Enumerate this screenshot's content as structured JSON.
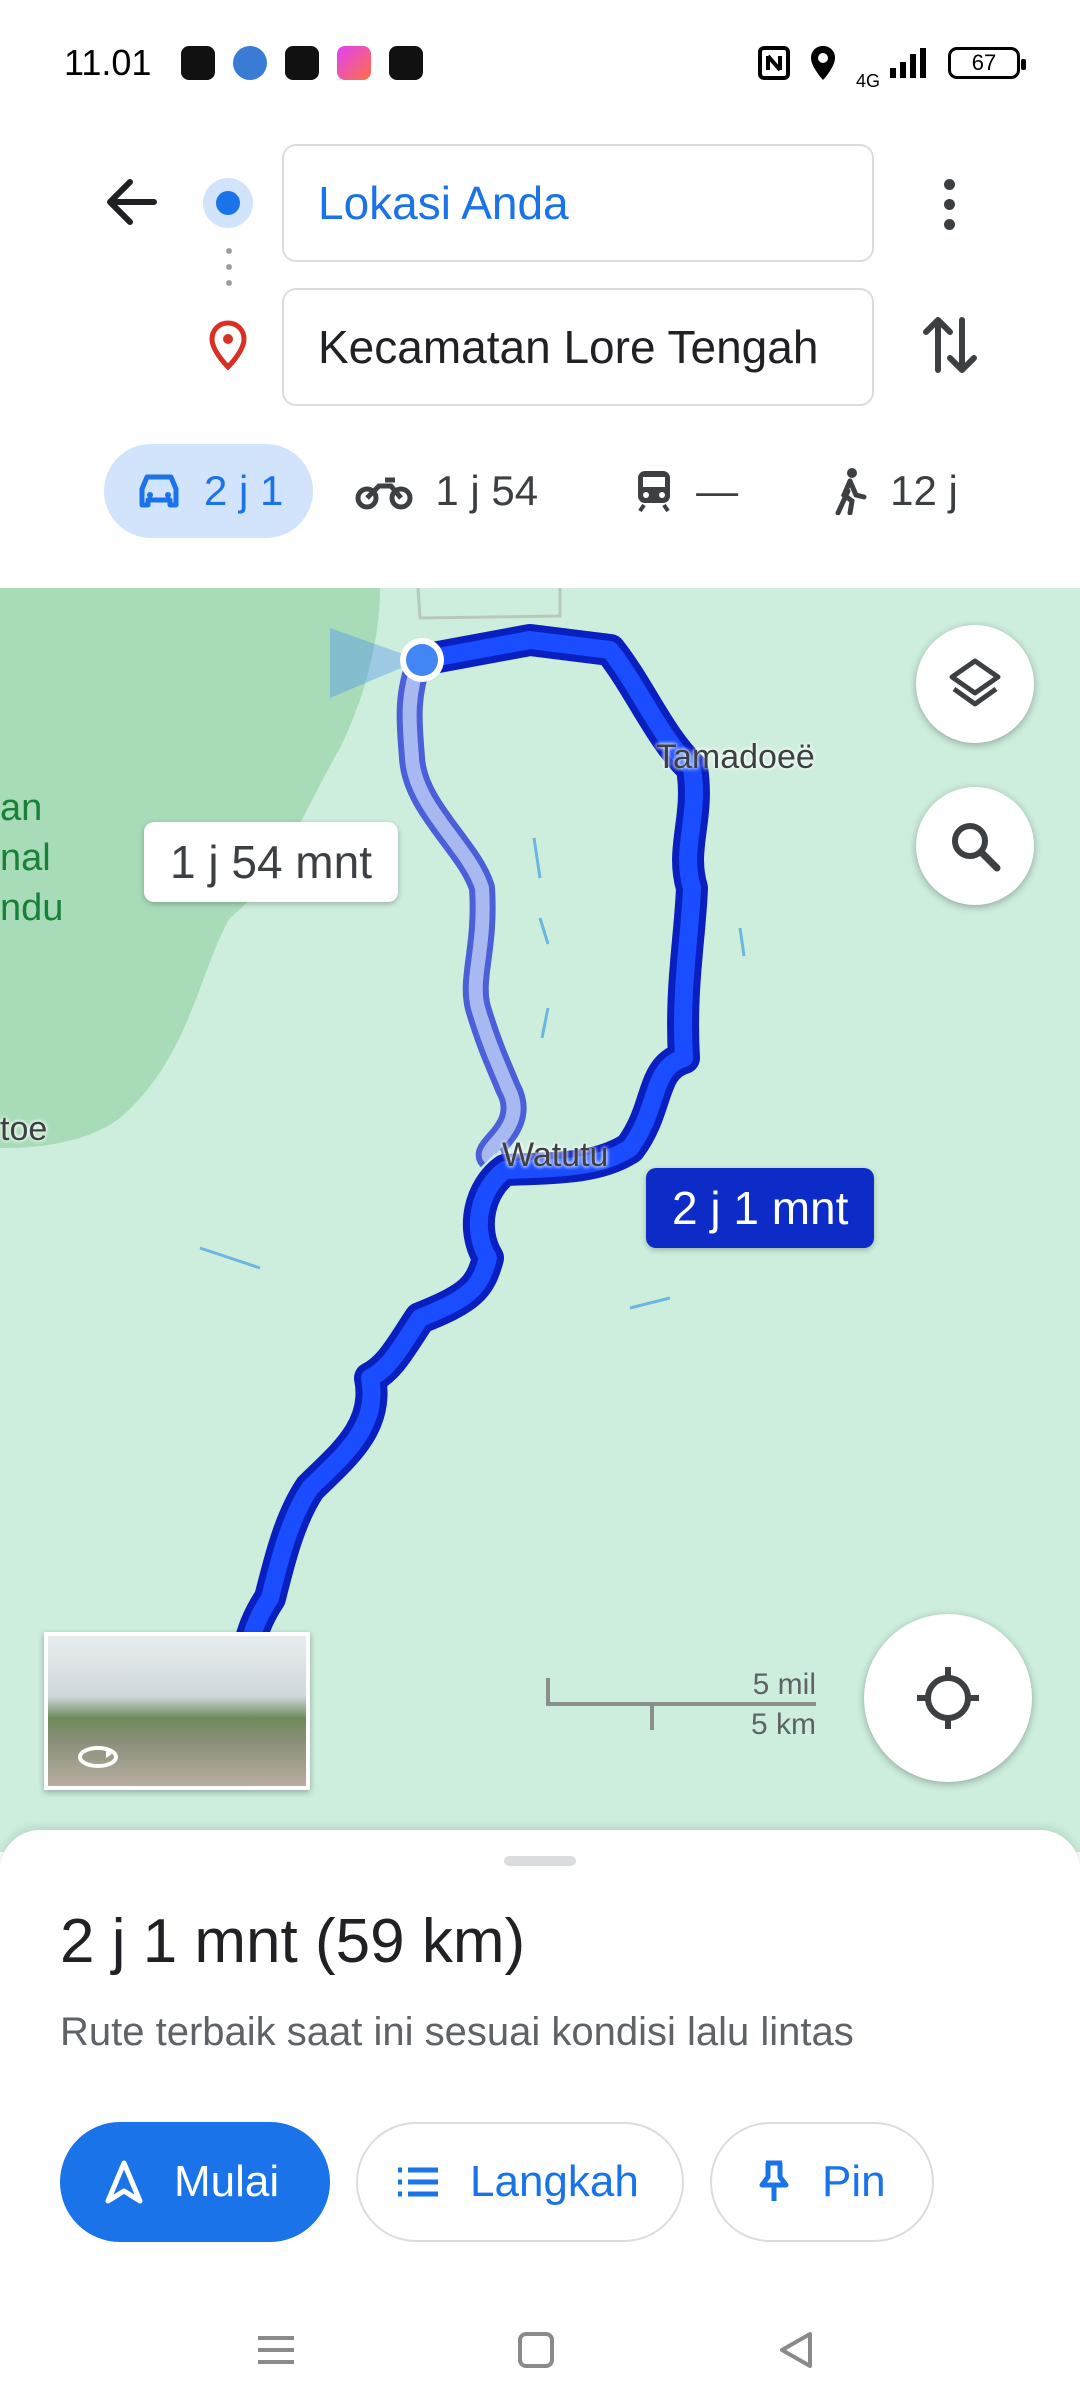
{
  "status_bar": {
    "time": "11.01",
    "network": "4G",
    "battery": "67",
    "icons": [
      "chat-bubble-icon",
      "app-icon",
      "line-icon",
      "shortcut-icon",
      "payment-icon",
      "nfc-icon",
      "location-icon",
      "signal-icon",
      "battery-icon"
    ]
  },
  "search": {
    "origin": "Lokasi Anda",
    "destination": "Kecamatan Lore Tengah"
  },
  "modes": [
    {
      "name": "car",
      "label": "2 j 1",
      "active": true
    },
    {
      "name": "motorcycle",
      "label": "1 j 54",
      "active": false
    },
    {
      "name": "transit",
      "label": "—",
      "active": false
    },
    {
      "name": "walk",
      "label": "12 j",
      "active": false
    }
  ],
  "map": {
    "places": [
      "Tamadoeë",
      "Watutu",
      "toe"
    ],
    "park_label": [
      "an",
      "nal",
      "ndu"
    ],
    "alt_route_time": "1 j 54 mnt",
    "main_route_time": "2 j 1 mnt",
    "scale": {
      "imperial": "5 mil",
      "metric": "5 km"
    }
  },
  "sheet": {
    "summary": "2 j 1 mnt (59 km)",
    "subtitle": "Rute terbaik saat ini sesuai kondisi lalu lintas",
    "start_label": "Mulai",
    "steps_label": "Langkah",
    "pin_label": "Pin"
  },
  "colors": {
    "accent": "#1a73e8",
    "route_main": "#0d2cc7",
    "route_alt": "#a8b8f0",
    "map_bg": "#cdeedc",
    "park": "#a8dcb8"
  }
}
